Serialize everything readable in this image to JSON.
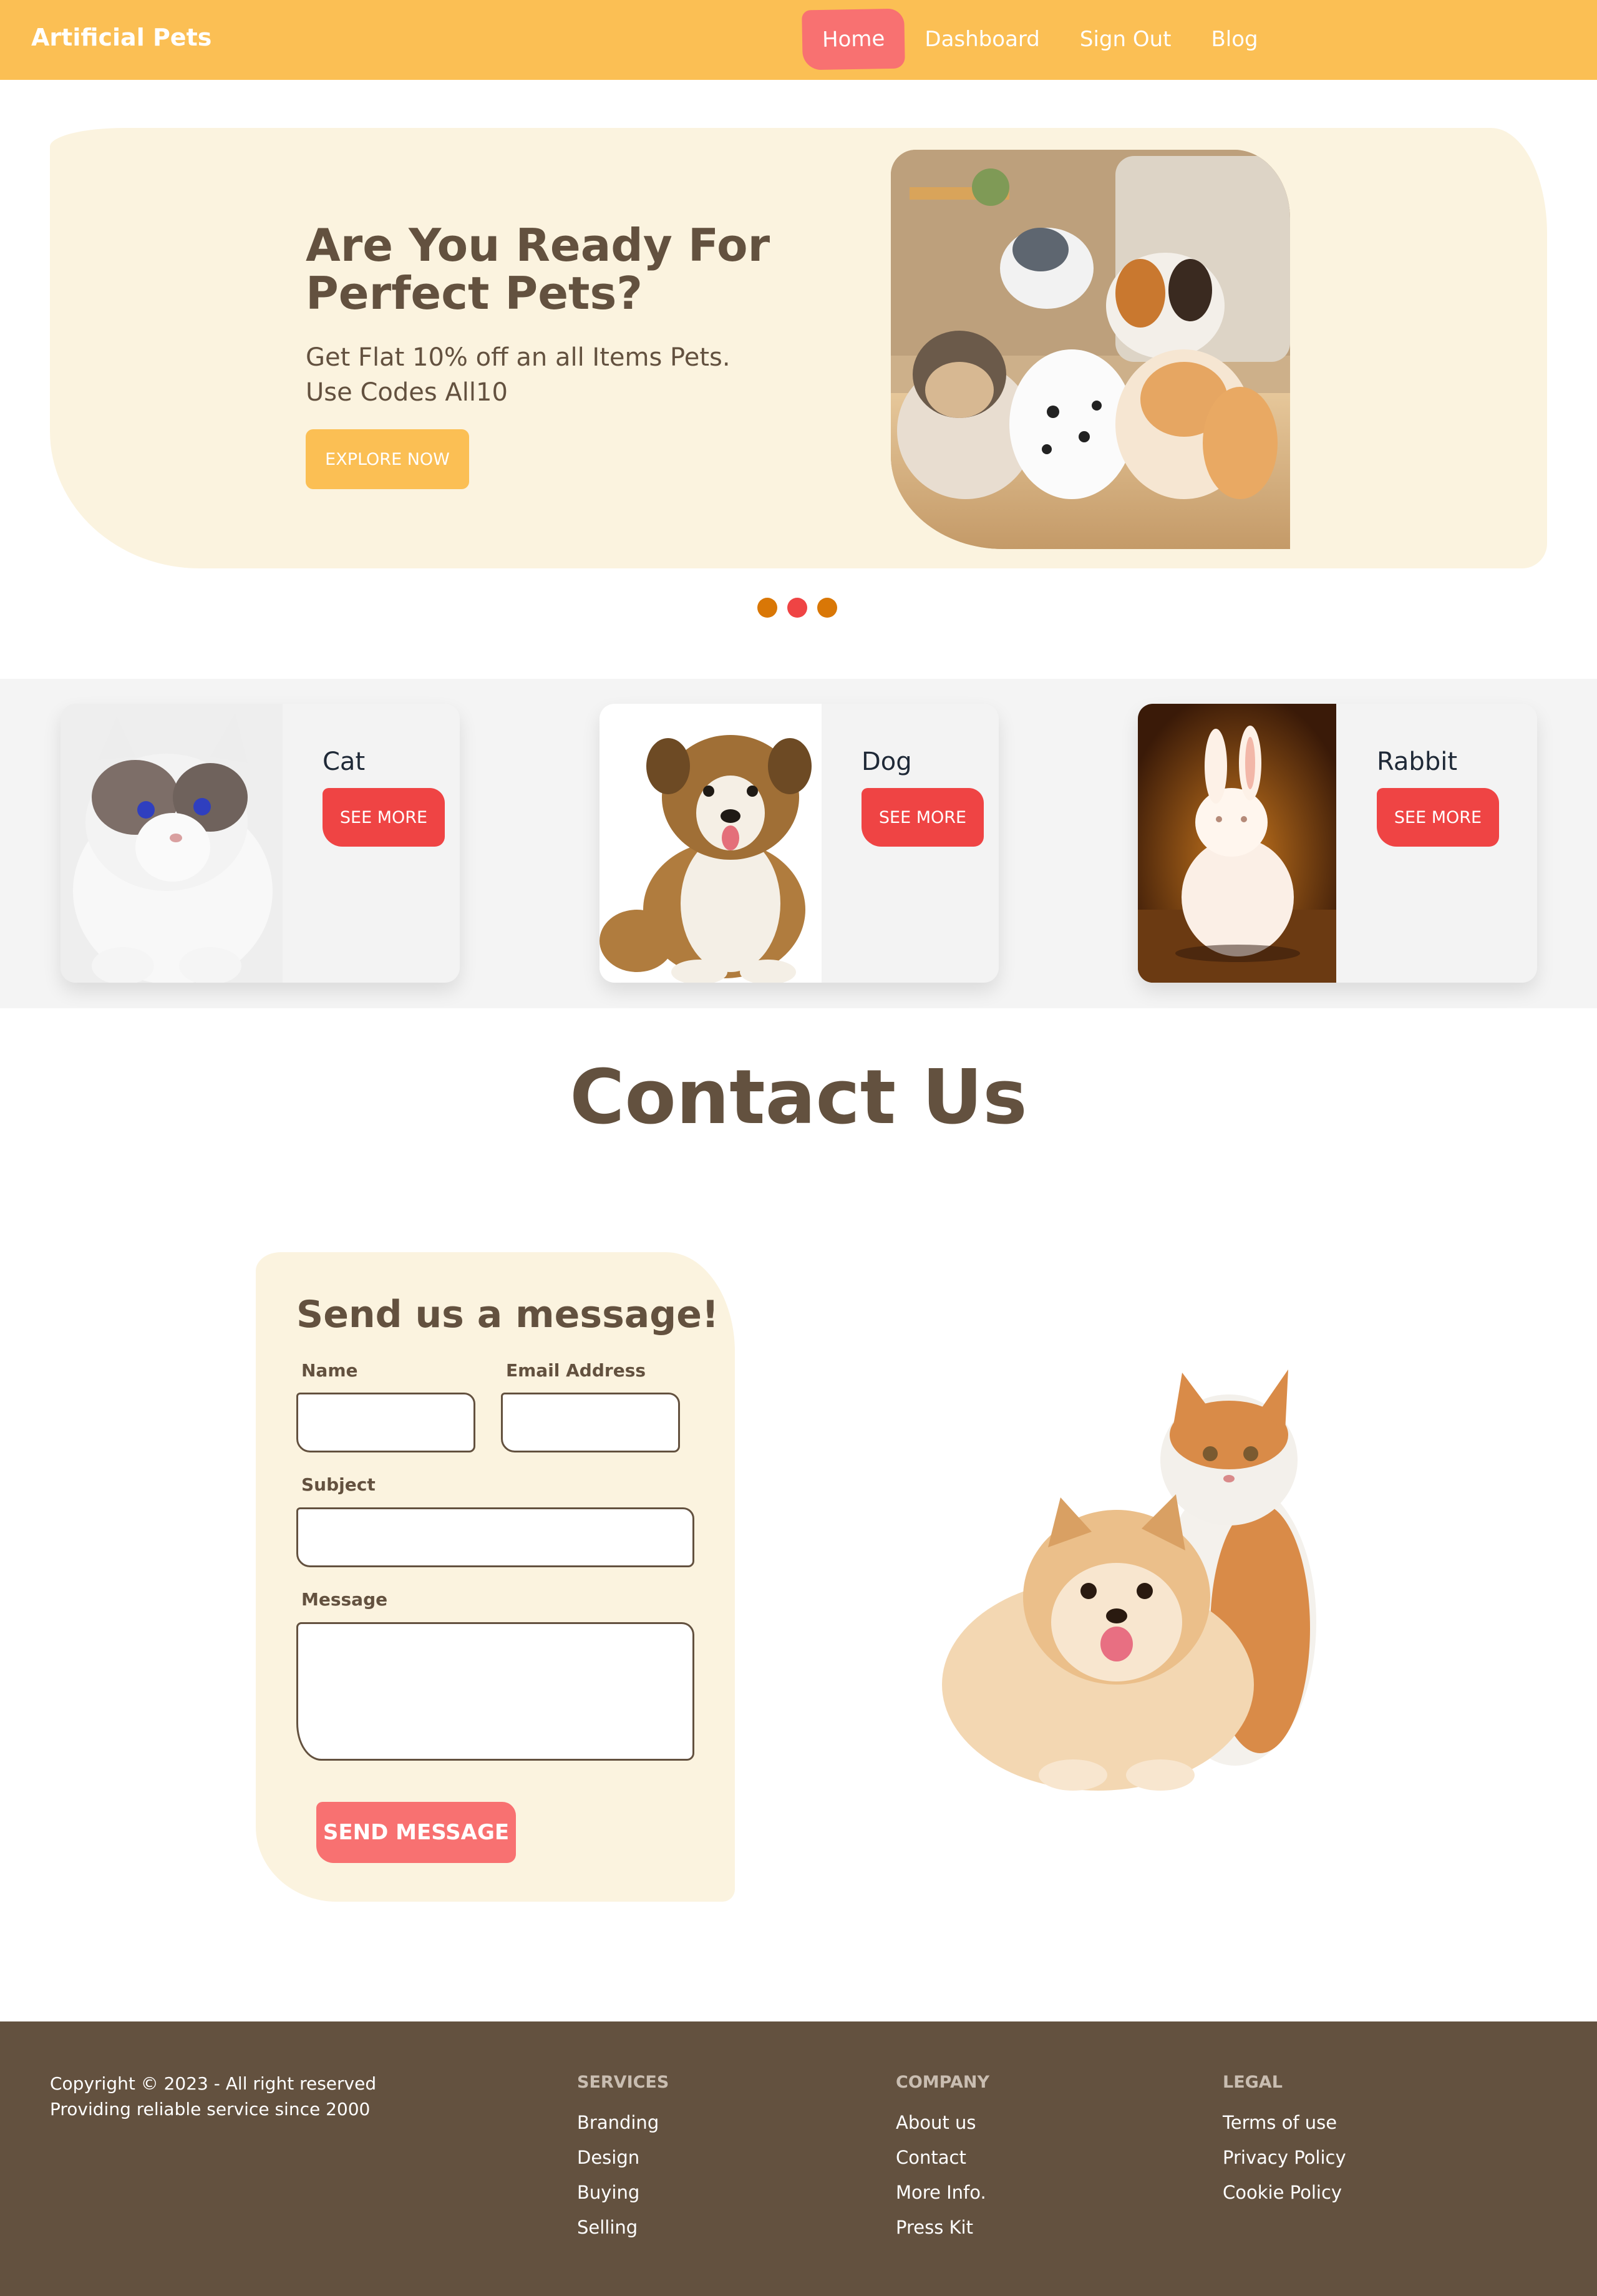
{
  "nav": {
    "brand": "Artificial Pets",
    "links": [
      "Home",
      "Dashboard",
      "Sign Out",
      "Blog"
    ]
  },
  "hero": {
    "title": "Are You Ready For Perfect Pets?",
    "subtitle_line1": "Get Flat 10% off an all Items Pets.",
    "subtitle_line2": "Use Codes All10",
    "cta": "EXPLORE NOW"
  },
  "carousel": {
    "slides": 3,
    "active": 1
  },
  "categories": [
    {
      "name": "Cat",
      "button": "SEE MORE"
    },
    {
      "name": "Dog",
      "button": "SEE MORE"
    },
    {
      "name": "Rabbit",
      "button": "SEE MORE"
    }
  ],
  "contact": {
    "title": "Contact Us",
    "form_heading": "Send us a message!",
    "name_label": "Name",
    "email_label": "Email Address",
    "subject_label": "Subject",
    "message_label": "Message",
    "submit": "SEND MESSAGE"
  },
  "footer": {
    "copyright": "Copyright © 2023 - All right reserved",
    "tagline": "Providing reliable service since 2000",
    "columns": [
      {
        "heading": "SERVICES",
        "links": [
          "Branding",
          "Design",
          "Buying",
          "Selling"
        ]
      },
      {
        "heading": "COMPANY",
        "links": [
          "About us",
          "Contact",
          "More Info.",
          "Press Kit"
        ]
      },
      {
        "heading": "LEGAL",
        "links": [
          "Terms of use",
          "Privacy Policy",
          "Cookie Policy"
        ]
      }
    ]
  },
  "colors": {
    "nav_bg": "#fbbf54",
    "hero_bg": "#fbf3df",
    "text_brown": "#63513f",
    "accent_red": "#ef4444",
    "accent_pink": "#f87171",
    "dot_orange": "#d97706",
    "footer_bg": "#63513f"
  }
}
